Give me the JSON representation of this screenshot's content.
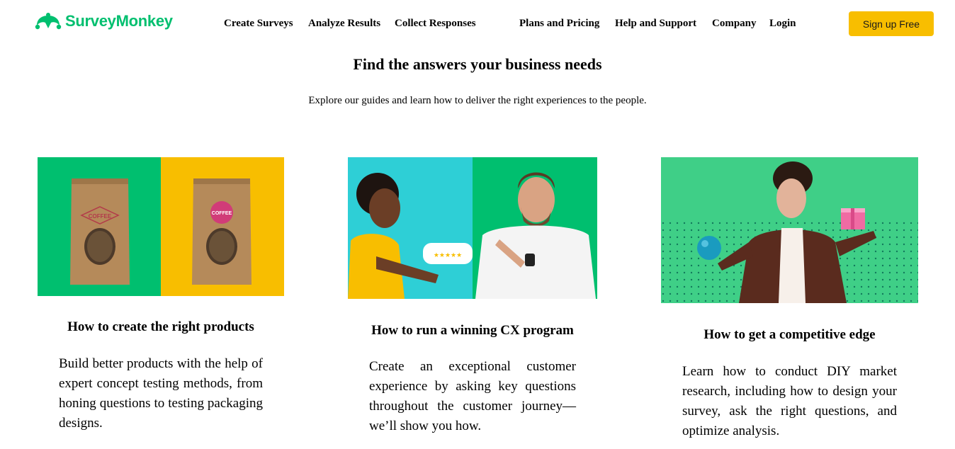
{
  "brand": {
    "name": "SurveyMonkey",
    "color": "#00bf6f"
  },
  "nav": {
    "items": [
      "Create Surveys",
      "Analyze Results",
      "Collect Responses",
      "Plans and Pricing",
      "Help and Support",
      "Company",
      "Login"
    ],
    "signup_label": "Sign up Free"
  },
  "hero": {
    "title": "Find the answers your business needs",
    "subtitle": "Explore our guides and learn how to deliver the right experiences to the people."
  },
  "cards": [
    {
      "title": "How to create the right products",
      "description": "Build better products with the help of expert concept testing methods, from honing questions to testing packaging designs.",
      "image": {
        "label": "COFFEE"
      }
    },
    {
      "title": "How to run a winning CX program",
      "description": "Create an exceptional customer experience by asking key questions throughout the customer journey—we’ll show you how.",
      "image": {
        "rating": "★★★★★"
      }
    },
    {
      "title": "How to get a competitive edge",
      "description": "Learn how to conduct DIY market research, including how to design your survey, ask the right questions, and optimize analysis.",
      "image": {}
    }
  ],
  "colors": {
    "accent_yellow": "#f8be00",
    "green": "#00bf6f",
    "teal": "#2ecfd6"
  }
}
